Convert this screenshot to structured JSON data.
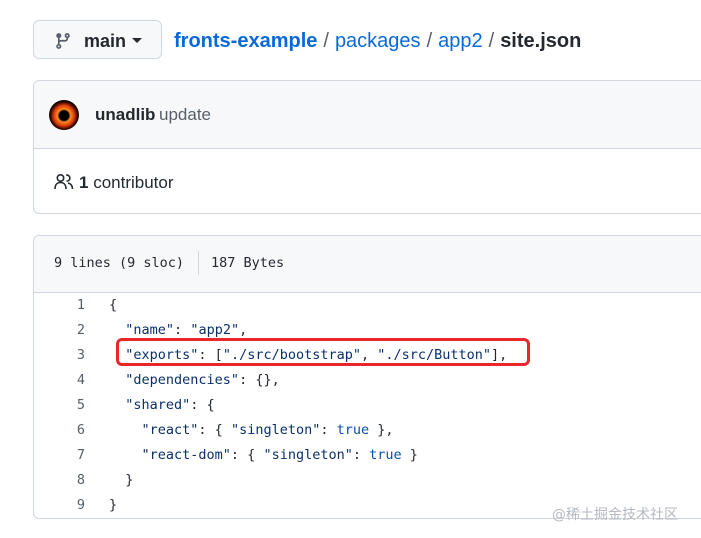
{
  "branch": {
    "label": "main",
    "icon": "git-branch-icon"
  },
  "breadcrumb": {
    "repo": "fronts-example",
    "sep": "/",
    "segments": [
      "packages",
      "app2"
    ],
    "current": "site.json"
  },
  "commit": {
    "author": "unadlib",
    "message": "update"
  },
  "contributors": {
    "count": "1",
    "label": "contributor",
    "icon": "people-icon"
  },
  "file": {
    "lines": "9 lines (9 sloc)",
    "size": "187 Bytes"
  },
  "code": {
    "line_numbers": [
      "1",
      "2",
      "3",
      "4",
      "5",
      "6",
      "7",
      "8",
      "9"
    ],
    "lines": [
      [
        {
          "t": "p",
          "v": "{"
        }
      ],
      [
        {
          "t": "p",
          "v": "  "
        },
        {
          "t": "k",
          "v": "\"name\""
        },
        {
          "t": "p",
          "v": ": "
        },
        {
          "t": "k",
          "v": "\"app2\""
        },
        {
          "t": "p",
          "v": ","
        }
      ],
      [
        {
          "t": "p",
          "v": "  "
        },
        {
          "t": "k",
          "v": "\"exports\""
        },
        {
          "t": "p",
          "v": ": ["
        },
        {
          "t": "k",
          "v": "\"./src/bootstrap\""
        },
        {
          "t": "p",
          "v": ", "
        },
        {
          "t": "k",
          "v": "\"./src/Button\""
        },
        {
          "t": "p",
          "v": "],"
        }
      ],
      [
        {
          "t": "p",
          "v": "  "
        },
        {
          "t": "k",
          "v": "\"dependencies\""
        },
        {
          "t": "p",
          "v": ": {},"
        }
      ],
      [
        {
          "t": "p",
          "v": "  "
        },
        {
          "t": "k",
          "v": "\"shared\""
        },
        {
          "t": "p",
          "v": ": {"
        }
      ],
      [
        {
          "t": "p",
          "v": "    "
        },
        {
          "t": "k",
          "v": "\"react\""
        },
        {
          "t": "p",
          "v": ": { "
        },
        {
          "t": "k",
          "v": "\"singleton\""
        },
        {
          "t": "p",
          "v": ": "
        },
        {
          "t": "b",
          "v": "true"
        },
        {
          "t": "p",
          "v": " },"
        }
      ],
      [
        {
          "t": "p",
          "v": "    "
        },
        {
          "t": "k",
          "v": "\"react-dom\""
        },
        {
          "t": "p",
          "v": ": { "
        },
        {
          "t": "k",
          "v": "\"singleton\""
        },
        {
          "t": "p",
          "v": ": "
        },
        {
          "t": "b",
          "v": "true"
        },
        {
          "t": "p",
          "v": " }"
        }
      ],
      [
        {
          "t": "p",
          "v": "  }"
        }
      ],
      [
        {
          "t": "p",
          "v": "}"
        }
      ]
    ]
  },
  "annotation": {
    "color": "#e8262c",
    "highlighted_line": "3"
  },
  "watermark": "@稀土掘金技术社区",
  "colors": {
    "link": "#0969da",
    "muted": "#57606a",
    "border": "#d0d7de",
    "header_bg": "#f6f8fa"
  }
}
